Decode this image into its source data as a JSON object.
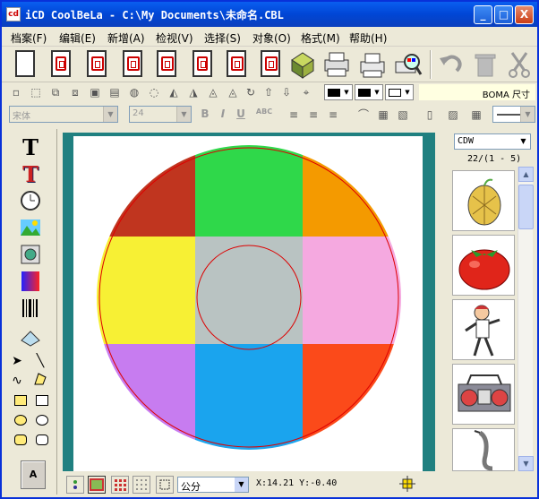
{
  "window": {
    "title": "iCD CoolBeLa - C:\\My Documents\\未命名.CBL",
    "minimize": "_",
    "maximize": "□",
    "close": "X"
  },
  "menu": [
    {
      "name": "menu-file",
      "label": "档案(F)"
    },
    {
      "name": "menu-edit",
      "label": "编辑(E)"
    },
    {
      "name": "menu-new",
      "label": "新增(A)"
    },
    {
      "name": "menu-view",
      "label": "检视(V)"
    },
    {
      "name": "menu-select",
      "label": "选择(S)"
    },
    {
      "name": "menu-object",
      "label": "对象(O)"
    },
    {
      "name": "menu-format",
      "label": "格式(M)"
    },
    {
      "name": "menu-help",
      "label": "帮助(H)"
    }
  ],
  "toolbar2": {
    "status_text": "BOMA 尺寸",
    "line_color": "#000000",
    "fill_color": "#000000",
    "bg_color": "#ffffff"
  },
  "format_bar": {
    "font_name": "宋体",
    "font_size": "24",
    "bold": "B",
    "italic": "I",
    "underline": "U",
    "strike": "ABC"
  },
  "left_tools": {
    "a_button": "A"
  },
  "clipart": {
    "library": "CDW",
    "counter": "22/(1 - 5)",
    "items": [
      "melon",
      "tomato",
      "karate-kid",
      "boombox",
      "saxophone"
    ]
  },
  "status": {
    "unit": "公分",
    "coords": "X:14.21 Y:-0.40"
  },
  "disc": {
    "colors": [
      "#c0351f",
      "#2fd84a",
      "#f49a00",
      "#f7f034",
      "#b9c3c2",
      "#f5a9e0",
      "#c77cf0",
      "#1aa4ee",
      "#fb4a1a"
    ]
  }
}
